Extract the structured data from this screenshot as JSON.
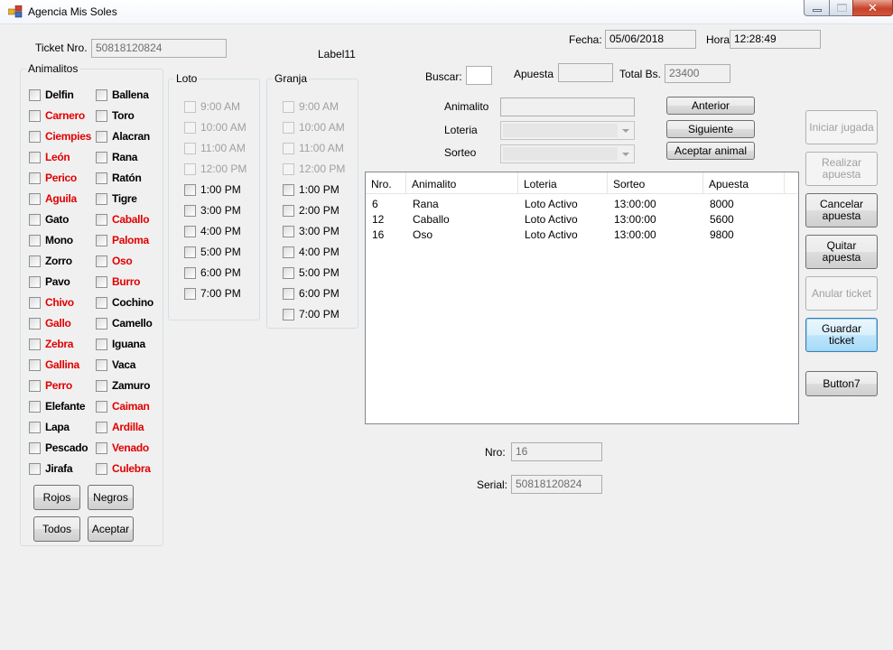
{
  "window": {
    "title": "Agencia Mis Soles"
  },
  "header": {
    "ticket_label": "Ticket Nro.",
    "ticket_value": "50818120824",
    "label11": "Label11",
    "fecha_label": "Fecha:",
    "fecha_value": "05/06/2018",
    "hora_label": "Hora:",
    "hora_value": "12:28:49"
  },
  "animalitos": {
    "title": "Animalitos",
    "col1": [
      {
        "label": "Delfin",
        "color": "black"
      },
      {
        "label": "Carnero",
        "color": "red"
      },
      {
        "label": "Ciempies",
        "color": "red"
      },
      {
        "label": "León",
        "color": "red"
      },
      {
        "label": "Perico",
        "color": "red"
      },
      {
        "label": "Aguila",
        "color": "red"
      },
      {
        "label": "Gato",
        "color": "black"
      },
      {
        "label": "Mono",
        "color": "black"
      },
      {
        "label": "Zorro",
        "color": "black"
      },
      {
        "label": "Pavo",
        "color": "black"
      },
      {
        "label": "Chivo",
        "color": "red"
      },
      {
        "label": "Gallo",
        "color": "red"
      },
      {
        "label": "Zebra",
        "color": "red"
      },
      {
        "label": "Gallina",
        "color": "red"
      },
      {
        "label": "Perro",
        "color": "red"
      },
      {
        "label": "Elefante",
        "color": "black"
      },
      {
        "label": "Lapa",
        "color": "black"
      },
      {
        "label": "Pescado",
        "color": "black"
      },
      {
        "label": "Jirafa",
        "color": "black"
      }
    ],
    "col2": [
      {
        "label": "Ballena",
        "color": "black"
      },
      {
        "label": "Toro",
        "color": "black"
      },
      {
        "label": "Alacran",
        "color": "black"
      },
      {
        "label": "Rana",
        "color": "black"
      },
      {
        "label": "Ratón",
        "color": "black"
      },
      {
        "label": "Tigre",
        "color": "black"
      },
      {
        "label": "Caballo",
        "color": "red"
      },
      {
        "label": "Paloma",
        "color": "red"
      },
      {
        "label": "Oso",
        "color": "red"
      },
      {
        "label": "Burro",
        "color": "red"
      },
      {
        "label": "Cochino",
        "color": "black"
      },
      {
        "label": "Camello",
        "color": "black"
      },
      {
        "label": "Iguana",
        "color": "black"
      },
      {
        "label": "Vaca",
        "color": "black"
      },
      {
        "label": "Zamuro",
        "color": "black"
      },
      {
        "label": "Caiman",
        "color": "red"
      },
      {
        "label": "Ardilla",
        "color": "red"
      },
      {
        "label": "Venado",
        "color": "red"
      },
      {
        "label": "Culebra",
        "color": "red"
      }
    ],
    "buttons": {
      "rojos": "Rojos",
      "negros": "Negros",
      "todos": "Todos",
      "aceptar": "Aceptar"
    }
  },
  "loto": {
    "title": "Loto",
    "times": [
      {
        "label": "9:00 AM",
        "enabled": false
      },
      {
        "label": "10:00 AM",
        "enabled": false
      },
      {
        "label": "11:00 AM",
        "enabled": false
      },
      {
        "label": "12:00 PM",
        "enabled": false
      },
      {
        "label": "1:00 PM",
        "enabled": true
      },
      {
        "label": "3:00 PM",
        "enabled": true
      },
      {
        "label": "4:00 PM",
        "enabled": true
      },
      {
        "label": "5:00 PM",
        "enabled": true
      },
      {
        "label": "6:00 PM",
        "enabled": true
      },
      {
        "label": "7:00 PM",
        "enabled": true
      }
    ]
  },
  "granja": {
    "title": "Granja",
    "times": [
      {
        "label": "9:00 AM",
        "enabled": false
      },
      {
        "label": "10:00 AM",
        "enabled": false
      },
      {
        "label": "11:00 AM",
        "enabled": false
      },
      {
        "label": "12:00 PM",
        "enabled": false
      },
      {
        "label": "1:00 PM",
        "enabled": true
      },
      {
        "label": "2:00 PM",
        "enabled": true
      },
      {
        "label": "3:00 PM",
        "enabled": true
      },
      {
        "label": "4:00 PM",
        "enabled": true
      },
      {
        "label": "5:00 PM",
        "enabled": true
      },
      {
        "label": "6:00 PM",
        "enabled": true
      },
      {
        "label": "7:00 PM",
        "enabled": true
      }
    ]
  },
  "search": {
    "buscar_label": "Buscar:",
    "buscar_value": "",
    "apuesta_label": "Apuesta",
    "apuesta_value": "",
    "total_label": "Total Bs.",
    "total_value": "23400"
  },
  "form": {
    "animalito_label": "Animalito",
    "animalito_value": "",
    "loteria_label": "Loteria",
    "loteria_value": "",
    "sorteo_label": "Sorteo",
    "sorteo_value": "",
    "anterior": "Anterior",
    "siguiente": "Siguiente",
    "aceptar_animal": "Aceptar animal"
  },
  "table": {
    "columns": [
      "Nro.",
      "Animalito",
      "Loteria",
      "Sorteo",
      "Apuesta"
    ],
    "rows": [
      [
        "6",
        "Rana",
        "Loto Activo",
        "13:00:00",
        "8000"
      ],
      [
        "12",
        "Caballo",
        "Loto Activo",
        "13:00:00",
        "5600"
      ],
      [
        "16",
        "Oso",
        "Loto Activo",
        "13:00:00",
        "9800"
      ]
    ]
  },
  "footer": {
    "nro_label": "Nro:",
    "nro_value": "16",
    "serial_label": "Serial:",
    "serial_value": "50818120824"
  },
  "actions": {
    "iniciar": "Iniciar jugada",
    "realizar": "Realizar apuesta",
    "cancelar": "Cancelar apuesta",
    "quitar": "Quitar apuesta",
    "anular": "Anular ticket",
    "guardar": "Guardar ticket",
    "button7": "Button7"
  }
}
